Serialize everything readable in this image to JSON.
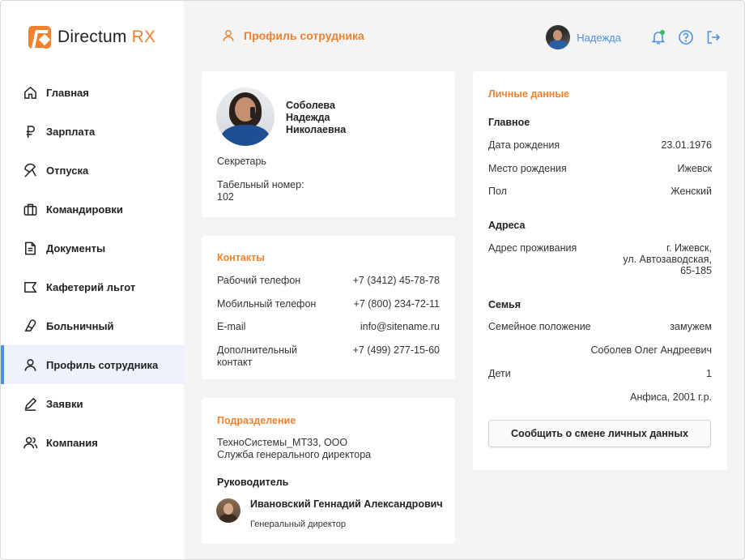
{
  "app": {
    "brand_main": "Directum",
    "brand_accent": "RX",
    "accent_color": "#f0812e",
    "link_color": "#4a90e2"
  },
  "sidebar": {
    "items": [
      {
        "label": "Главная",
        "icon": "home-icon"
      },
      {
        "label": "Зарплата",
        "icon": "ruble-icon"
      },
      {
        "label": "Отпуска",
        "icon": "umbrella-icon"
      },
      {
        "label": "Командировки",
        "icon": "briefcase-icon"
      },
      {
        "label": "Документы",
        "icon": "document-icon"
      },
      {
        "label": "Кафетерий льгот",
        "icon": "flag-icon"
      },
      {
        "label": "Больничный",
        "icon": "pill-icon"
      },
      {
        "label": "Профиль сотрудника",
        "icon": "user-icon",
        "active": true
      },
      {
        "label": "Заявки",
        "icon": "pen-icon"
      },
      {
        "label": "Компания",
        "icon": "users-icon"
      }
    ]
  },
  "header": {
    "title": "Профиль сотрудника",
    "user_name": "Надежда"
  },
  "profile": {
    "last_name": "Соболева",
    "first_name": "Надежда",
    "middle_name": "Николаевна",
    "position": "Секретарь",
    "tab_number_label": "Табельный номер:",
    "tab_number": "102"
  },
  "contacts": {
    "title": "Контакты",
    "rows": [
      {
        "label": "Рабочий телефон",
        "value": "+7 (3412) 45-78-78"
      },
      {
        "label": "Мобильный телефон",
        "value": "+7 (800) 234-72-11"
      },
      {
        "label": "E-mail",
        "value": "info@sitename.ru"
      },
      {
        "label": "Дополнительный контакт",
        "label_line1": "Дополнительный",
        "label_line2": "контакт",
        "value": "+7 (499) 277-15-60"
      }
    ]
  },
  "department": {
    "title": "Подразделение",
    "org": "ТехноСистемы_МТ33, ООО",
    "service": "Служба генерального директора",
    "manager_title": "Руководитель",
    "manager_name": "Ивановский Геннадий Александрович",
    "manager_position": "Генеральный директор"
  },
  "personal": {
    "title": "Личные данные",
    "main_title": "Главное",
    "birth_date_label": "Дата рождения",
    "birth_date": "23.01.1976",
    "birth_place_label": "Место рождения",
    "birth_place": "Ижевск",
    "gender_label": "Пол",
    "gender": "Женский",
    "address_title": "Адреса",
    "address_label": "Адрес проживания",
    "address_line1": "г. Ижевск,",
    "address_line2": "ул. Автозаводская,",
    "address_line3": "65-185",
    "family_title": "Семья",
    "marital_label": "Семейное положение",
    "marital": "замужем",
    "spouse": "Соболев Олег Андреевич",
    "children_label": "Дети",
    "children_count": "1",
    "child": "Анфиса, 2001 г.р.",
    "report_button": "Сообщить о смене личных данных"
  }
}
